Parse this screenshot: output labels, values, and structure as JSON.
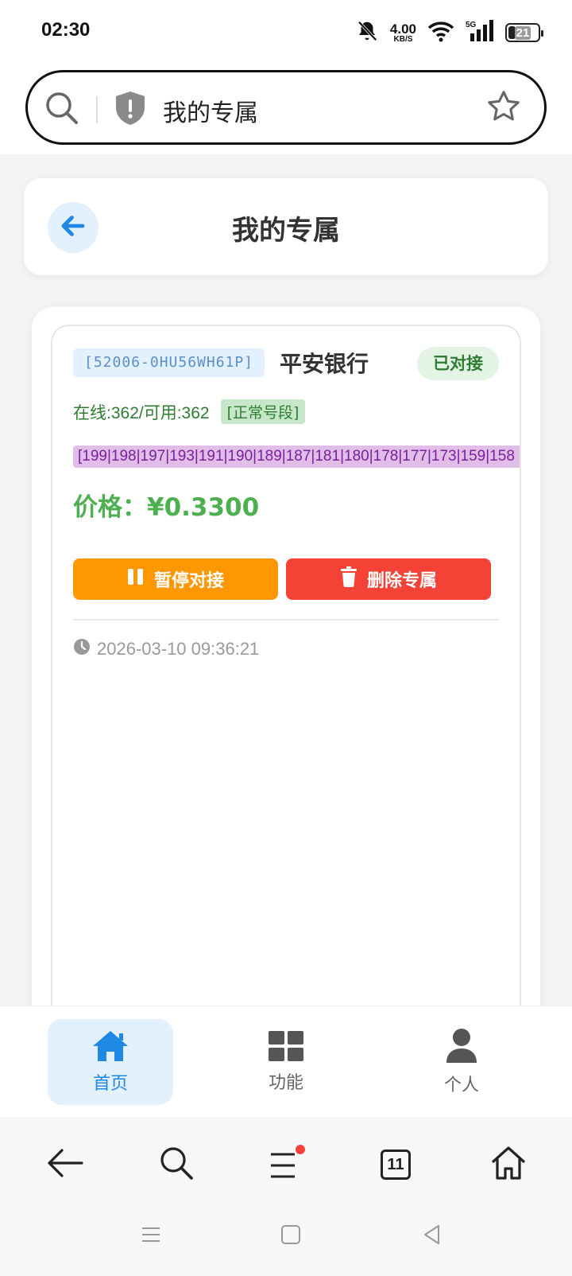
{
  "status_bar": {
    "time": "02:30",
    "net_speed_value": "4.00",
    "net_speed_unit": "KB/S",
    "network": "5G",
    "battery": "21"
  },
  "browser": {
    "address_text": "我的专属"
  },
  "header": {
    "title": "我的专属"
  },
  "card": {
    "code": "[52006-0HU56WH61P]",
    "bank": "平安银行",
    "status": "已对接",
    "online": "在线:362/可用:362",
    "segment_tag": "[正常号段]",
    "prefixes": "[199|198|197|193|191|190|189|187|181|180|178|177|173|159|158",
    "price": "价格：¥0.3300",
    "pause_button": "暂停对接",
    "delete_button": "删除专属",
    "timestamp": "2026-03-10 09:36:21"
  },
  "tabbar": {
    "home": "首页",
    "functions": "功能",
    "me": "个人"
  },
  "browser_toolbar": {
    "tab_count": "11"
  },
  "colors": {
    "primary": "#1e88e5",
    "success": "#4caf50",
    "warning": "#ff9800",
    "danger": "#f44336",
    "purple_tag": "#7b1fa2"
  },
  "icons": [
    "bell-muted-icon",
    "wifi-icon",
    "signal-icon",
    "battery-icon",
    "search-icon",
    "shield-icon",
    "star-icon",
    "back-arrow-icon",
    "pause-icon",
    "trash-icon",
    "clock-icon",
    "home-icon",
    "grid-icon",
    "person-icon",
    "menu-icon",
    "tabs-icon",
    "browser-home-icon"
  ]
}
